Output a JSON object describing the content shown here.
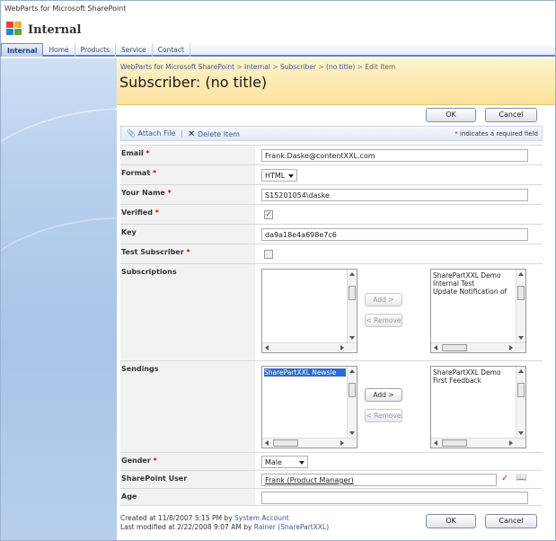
{
  "site": {
    "name": "WebParts for Microsoft SharePoint",
    "title": "Internal"
  },
  "tabs": [
    "Internal",
    "Home",
    "Products",
    "Service",
    "Contact"
  ],
  "breadcrumb": [
    "WebParts for Microsoft SharePoint",
    "Internal",
    "Subscriber",
    "(no title)",
    "Edit Item"
  ],
  "breadcrumb_sep": ">",
  "page_title": "Subscriber: (no title)",
  "buttons": {
    "ok": "OK",
    "cancel": "Cancel"
  },
  "toolbar": {
    "attach": "Attach File",
    "divider": "|",
    "delete": "Delete Item",
    "required_star": "*",
    "required_text": "indicates a required field"
  },
  "form": {
    "required_mark": "*",
    "email": {
      "label": "Email",
      "value": "Frank.Daske@contentXXL.com"
    },
    "format": {
      "label": "Format",
      "value": "HTML"
    },
    "your_name": {
      "label": "Your Name",
      "value": "S15201054\\daske"
    },
    "verified": {
      "label": "Verified",
      "checked": true
    },
    "key": {
      "label": "Key",
      "value": "da9a18e4a698e7c6"
    },
    "test_subscriber": {
      "label": "Test Subscriber",
      "checked": false
    },
    "subscriptions": {
      "label": "Subscriptions",
      "available": [],
      "selected": [
        "SharePartXXL Demo",
        "Internal Test",
        "Update Notification of"
      ],
      "add": "Add >",
      "remove": "< Remove"
    },
    "sendings": {
      "label": "Sendings",
      "available": [
        "SharePartXXL Newsle"
      ],
      "selected": [
        "SharePartXXL Demo",
        "First Feedback"
      ],
      "add": "Add >",
      "remove": "< Remove"
    },
    "gender": {
      "label": "Gender",
      "value": "Male"
    },
    "sharepoint_user": {
      "label": "SharePoint User",
      "value": "Frank (Product Manager)"
    },
    "age": {
      "label": "Age",
      "value": ""
    }
  },
  "footer": {
    "created_prefix": "Created at 11/8/2007 5:15 PM  by",
    "created_by": "System Account",
    "modified_prefix": "Last modified at 2/22/2008 9:07 AM  by",
    "modified_by": "Rainer (SharePartXXL)"
  },
  "colors": {
    "header_band": "#fbe19a",
    "tab_accent": "#5b86bd",
    "required": "#d30000",
    "link": "#3d5a95"
  }
}
